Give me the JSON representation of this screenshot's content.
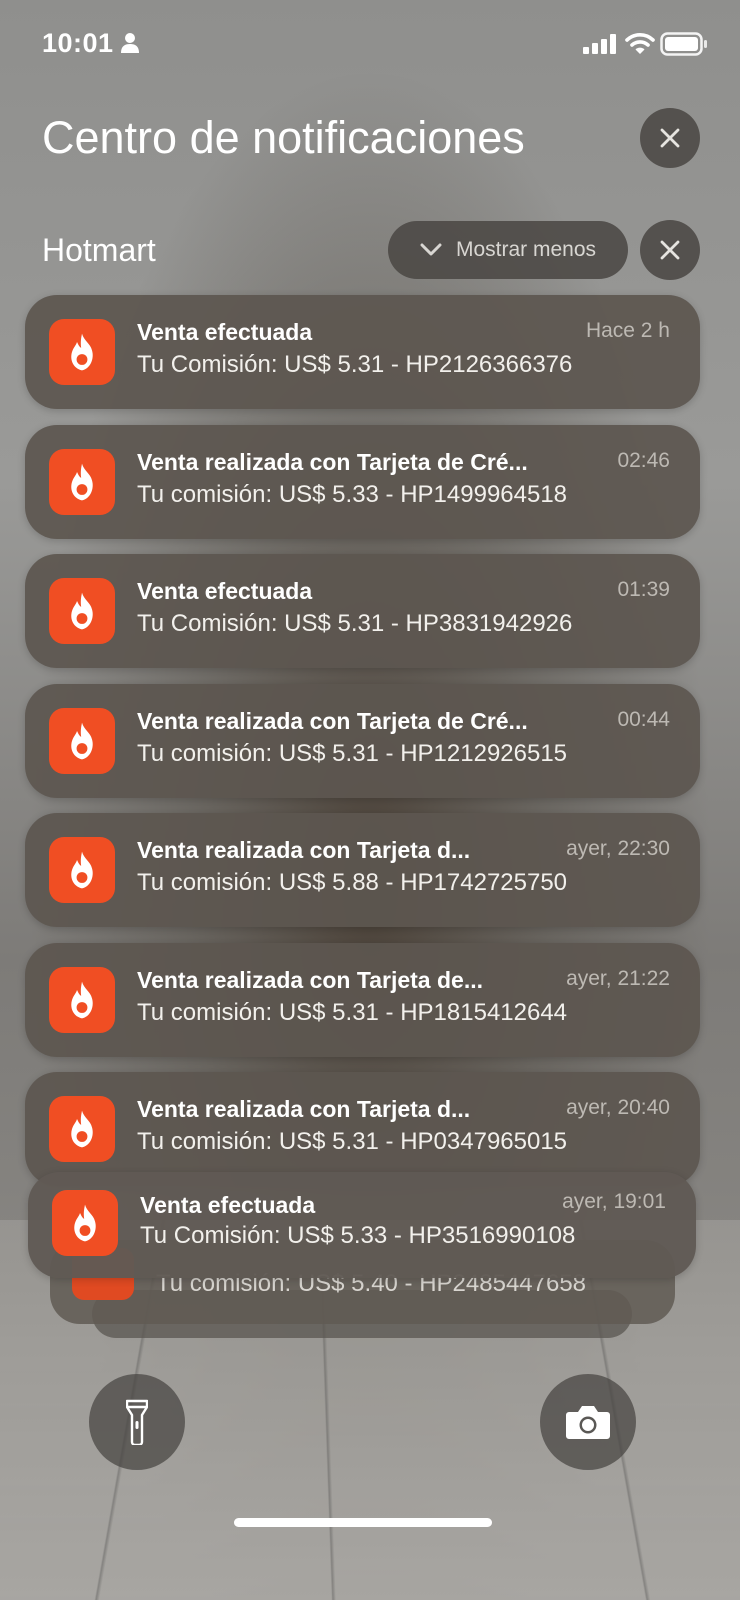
{
  "status_bar": {
    "time": "10:01",
    "icons": [
      "person-icon",
      "cellular-signal-icon",
      "wifi-icon",
      "battery-icon"
    ]
  },
  "notification_center": {
    "title": "Centro de notificaciones",
    "close_icon": "close-icon"
  },
  "group": {
    "app_name": "Hotmart",
    "show_less_label": "Mostrar menos",
    "show_less_icon": "chevron-down-icon",
    "close_icon": "close-icon",
    "notifications": [
      {
        "title": "Venta efectuada",
        "time": "Hace 2 h",
        "body": "Tu Comisión: US$ 5.31 - HP2126366376"
      },
      {
        "title": "Venta realizada con Tarjeta de Cré...",
        "time": "02:46",
        "body": "Tu comisión: US$ 5.33 - HP1499964518"
      },
      {
        "title": "Venta efectuada",
        "time": "01:39",
        "body": "Tu Comisión: US$ 5.31 - HP3831942926"
      },
      {
        "title": "Venta realizada con Tarjeta de Cré...",
        "time": "00:44",
        "body": "Tu comisión: US$ 5.31 - HP1212926515"
      },
      {
        "title": "Venta realizada con Tarjeta d...",
        "time": "ayer, 22:30",
        "body": "Tu comisión: US$ 5.88 - HP1742725750"
      },
      {
        "title": "Venta realizada con Tarjeta de...",
        "time": "ayer, 21:22",
        "body": "Tu comisión: US$ 5.31 - HP1815412644"
      },
      {
        "title": "Venta realizada con Tarjeta d...",
        "time": "ayer, 20:40",
        "body": "Tu comisión: US$ 5.31 - HP0347965015"
      }
    ],
    "front_notification": {
      "title": "Venta efectuada",
      "time": "ayer, 19:01",
      "body": "Tu Comisión: US$ 5.33 - HP3516990108"
    },
    "stacked_notification": {
      "body": "Tu comisión: US$ 5.40 - HP2485447658"
    }
  },
  "quick_actions": {
    "flashlight_icon": "flashlight-icon",
    "camera_icon": "camera-icon"
  },
  "colors": {
    "app_icon": "#f04e23",
    "card": "#5c5650"
  }
}
